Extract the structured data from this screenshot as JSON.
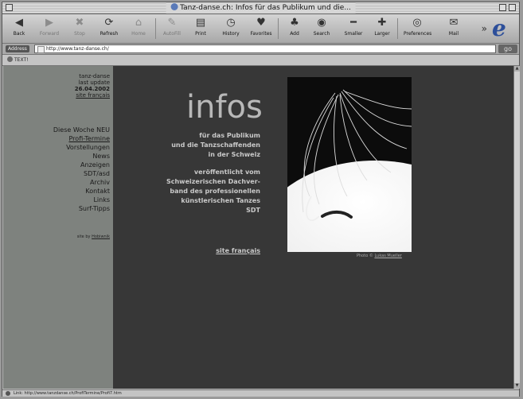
{
  "window": {
    "title": "Tanz-danse.ch: Infos für das Publikum und die..."
  },
  "toolbar": {
    "buttons": [
      {
        "label": "Back",
        "icon": "back-arrow-icon",
        "enabled": true
      },
      {
        "label": "Forward",
        "icon": "forward-arrow-icon",
        "enabled": false
      },
      {
        "label": "Stop",
        "icon": "stop-icon",
        "enabled": false
      },
      {
        "label": "Refresh",
        "icon": "refresh-icon",
        "enabled": true
      },
      {
        "label": "Home",
        "icon": "home-icon",
        "enabled": false
      },
      {
        "label": "AutoFill",
        "icon": "autofill-icon",
        "enabled": false
      },
      {
        "label": "Print",
        "icon": "print-icon",
        "enabled": true
      },
      {
        "label": "History",
        "icon": "history-icon",
        "enabled": true
      },
      {
        "label": "Favorites",
        "icon": "favorites-icon",
        "enabled": true
      },
      {
        "label": "Add",
        "icon": "add-icon",
        "enabled": true
      },
      {
        "label": "Search",
        "icon": "search-icon",
        "enabled": true
      },
      {
        "label": "Smaller",
        "icon": "smaller-icon",
        "enabled": true
      },
      {
        "label": "Larger",
        "icon": "larger-icon",
        "enabled": true
      },
      {
        "label": "Preferences",
        "icon": "preferences-icon",
        "enabled": true
      },
      {
        "label": "Mail",
        "icon": "mail-icon",
        "enabled": true
      }
    ]
  },
  "address": {
    "label": "Address",
    "url": "http://www.tanz-danse.ch/",
    "go_label": "go"
  },
  "favorites": {
    "item": "TEXT!"
  },
  "sidebar": {
    "site_name": "tanz-danse",
    "last_update_label": "last update",
    "last_update_date": "26.04.2002",
    "lang_link": "site français",
    "nav": [
      {
        "label": "Diese Woche NEU",
        "active": false
      },
      {
        "label": "Profi-Termine",
        "active": true
      },
      {
        "label": "Vorstellungen",
        "active": false
      },
      {
        "label": "News",
        "active": false
      },
      {
        "label": "Anzeigen",
        "active": false
      },
      {
        "label": "SDT/asd",
        "active": false
      },
      {
        "label": "Archiv",
        "active": false
      },
      {
        "label": "Kontakt",
        "active": false
      },
      {
        "label": "Links",
        "active": false
      },
      {
        "label": "Surf-Tipps",
        "active": false
      }
    ],
    "credit_prefix": "site by",
    "credit_link": "Hobiwnik"
  },
  "main": {
    "headline": "infos",
    "subtitle_lines": [
      "für das Publikum",
      "und die Tanzschaffenden",
      "in der Schweiz"
    ],
    "publisher_lines": [
      "veröffentlicht vom",
      "Schweizerischen Dachver-",
      "band des professionellen",
      "künstlerischen Tanzes",
      "SDT"
    ],
    "french_link": "site français",
    "photo_caption_prefix": "Photo ©",
    "photo_caption_link": "Lukas Mueller"
  },
  "status": {
    "text": "Link: http://www.tanzdanse.ch/ProfiTermine/Profi7.htm"
  }
}
